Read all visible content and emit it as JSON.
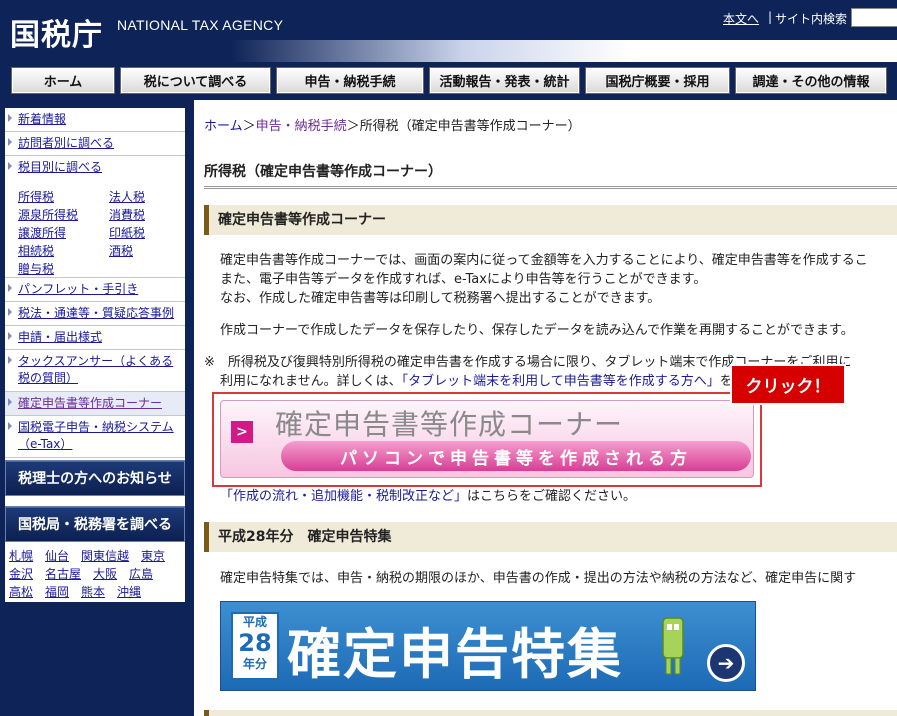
{
  "header": {
    "logo_kanji": "国税庁",
    "logo_en": "NATIONAL TAX AGENCY",
    "link_main_text": "本文へ",
    "separator": "|",
    "site_search_label": "サイト内検索",
    "site_search_value": ""
  },
  "global_nav": {
    "items": [
      {
        "label": "ホーム"
      },
      {
        "label": "税について調べる"
      },
      {
        "label": "申告・納税手続"
      },
      {
        "label": "活動報告・発表・統計"
      },
      {
        "label": "国税庁概要・採用"
      },
      {
        "label": "調達・その他の情報"
      }
    ]
  },
  "sidebar": {
    "items": [
      {
        "label": "新着情報"
      },
      {
        "label": "訪問者別に調べる"
      },
      {
        "label": "税目別に調べる"
      }
    ],
    "tax_items": [
      {
        "label": "所得税"
      },
      {
        "label": "法人税"
      },
      {
        "label": "源泉所得税"
      },
      {
        "label": "消費税"
      },
      {
        "label": "譲渡所得"
      },
      {
        "label": "印紙税"
      },
      {
        "label": "相続税"
      },
      {
        "label": "酒税"
      },
      {
        "label": "贈与税"
      }
    ],
    "items2": [
      {
        "label": "パンフレット・手引き"
      },
      {
        "label": "税法・通達等・質疑応答事例"
      },
      {
        "label": "申請・届出様式"
      },
      {
        "label": "タックスアンサー（よくある税の質問）"
      },
      {
        "label": "確定申告書等作成コーナー"
      },
      {
        "label": "国税電子申告・納税システム（e-Tax）"
      }
    ],
    "banner_tax_accountant": "税理士の方へのお知らせ",
    "banner_offices": "国税局・税務署を調べる",
    "offices": [
      {
        "label": "札幌"
      },
      {
        "label": "仙台"
      },
      {
        "label": "関東信越"
      },
      {
        "label": "東京"
      },
      {
        "label": "金沢"
      },
      {
        "label": "名古屋"
      },
      {
        "label": "大阪"
      },
      {
        "label": "広島"
      },
      {
        "label": "高松"
      },
      {
        "label": "福岡"
      },
      {
        "label": "熊本"
      },
      {
        "label": "沖縄"
      }
    ]
  },
  "main": {
    "breadcrumb": {
      "home": "ホーム",
      "sep1": "＞",
      "filing": "申告・納税手続",
      "sep2": "＞",
      "current": "所得税（確定申告書等作成コーナー）"
    },
    "page_title": "所得税（確定申告書等作成コーナー）",
    "section1": {
      "heading": "確定申告書等作成コーナー",
      "p1": "確定申告書等作成コーナーでは、画面の案内に従って金額等を入力することにより、確定申告書等を作成するこ",
      "p2": "また、電子申告等データを作成すれば、e-Taxにより申告等を行うことができます。",
      "p3": "なお、作成した確定申告書等は印刷して税務署へ提出することができます。",
      "p4": "作成コーナーで作成したデータを保存したり、保存したデータを読み込んで作業を再開することができます。",
      "note_line1": "※　所得税及び復興特別所得税の確定申告書を作成する場合に限り、タブレット端末で作成コーナーをご利用に",
      "note_line2_prefix": "利用になれません。詳しくは、",
      "note_link": "「タブレット端末を利用して申告書等を作成する方へ」",
      "note_line2_suffix": "を",
      "banner_title": "確定申告書等作成コーナー",
      "banner_sub": "パソコンで申告書等を作成される方",
      "banner_arrow": ">",
      "click_badge": "クリック！",
      "flow_link": "「作成の流れ・追加機能・税制改正など」",
      "flow_suffix": "はこちらをご確認ください。"
    },
    "section2": {
      "heading": "平成28年分　確定申告特集",
      "p1": "確定申告特集では、申告・納税の期限のほか、申告書の作成・提出の方法や納税の方法など、確定申告に関す",
      "banner_year_top": "平成",
      "banner_year_num": "28",
      "banner_year_bottom": "年分",
      "banner_title": "確定申告特集",
      "banner_go": "➔"
    }
  }
}
